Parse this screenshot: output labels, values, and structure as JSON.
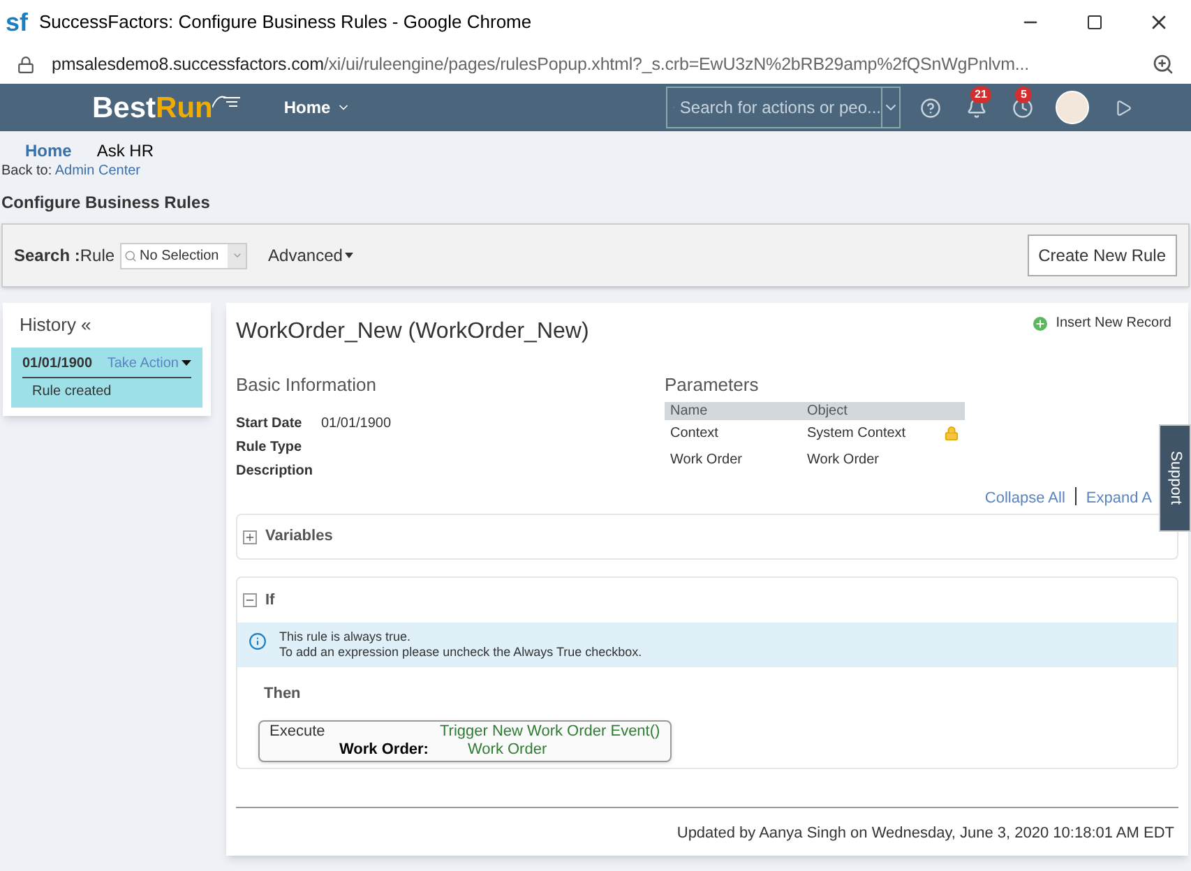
{
  "window": {
    "app_icon": "sf",
    "title": "SuccessFactors: Configure Business Rules - Google Chrome"
  },
  "address_bar": {
    "url_host": "pmsalesdemo8.successfactors.com",
    "url_path": "/xi/ui/ruleengine/pages/rulesPopup.xhtml?_s.crb=EwU3zN%2bRB29amp%2fQSnWgPnlvm..."
  },
  "header": {
    "logo_first": "Best",
    "logo_second": "Run",
    "home_menu": "Home",
    "search_placeholder": "Search for actions or peo...",
    "notification_count": "21",
    "todo_count": "5"
  },
  "nav": [
    {
      "label": "Home",
      "selected": true
    },
    {
      "label": "Ask HR",
      "selected": false
    }
  ],
  "back_to": {
    "label": "Back to:",
    "link": "Admin Center"
  },
  "page_title": "Configure Business Rules",
  "search_bar": {
    "label": "Search :",
    "field_label": "Rule",
    "select_value": "No Selection",
    "advanced": "Advanced",
    "create_button": "Create New Rule"
  },
  "history": {
    "title": "History «",
    "entries": [
      {
        "date": "01/01/1900",
        "action": "Take Action",
        "note": "Rule created",
        "selected": true
      }
    ]
  },
  "rule": {
    "title": "WorkOrder_New (WorkOrder_New)",
    "insert_button": "Insert New Record",
    "basic_info": {
      "heading": "Basic Information",
      "fields": [
        {
          "label": "Start Date",
          "value": "01/01/1900"
        },
        {
          "label": "Rule Type"
        },
        {
          "label": "Description"
        }
      ]
    },
    "parameters": {
      "heading": "Parameters",
      "columns": [
        "Name",
        "Object"
      ],
      "rows": [
        {
          "name": "Context",
          "object": "System Context",
          "locked": true
        },
        {
          "name": "Work Order",
          "object": "Work Order",
          "locked": false
        }
      ]
    },
    "collapse_all": "Collapse All",
    "expand_all": "Expand A",
    "variables": {
      "label": "Variables",
      "expanded": false
    },
    "if_section": {
      "label": "If",
      "expanded": true,
      "info_lines": [
        "This rule is always true.",
        "To add an expression please uncheck the Always True checkbox."
      ]
    },
    "then_label": "Then",
    "action": {
      "keyword": "Execute",
      "call": "Trigger New Work Order Event()",
      "param_label": "Work Order:",
      "param_value": "Work Order"
    },
    "footer_note": "Updated by Aanya Singh on Wednesday, June 3, 2020 10:18:01 AM EDT"
  },
  "support_tab": "Support"
}
